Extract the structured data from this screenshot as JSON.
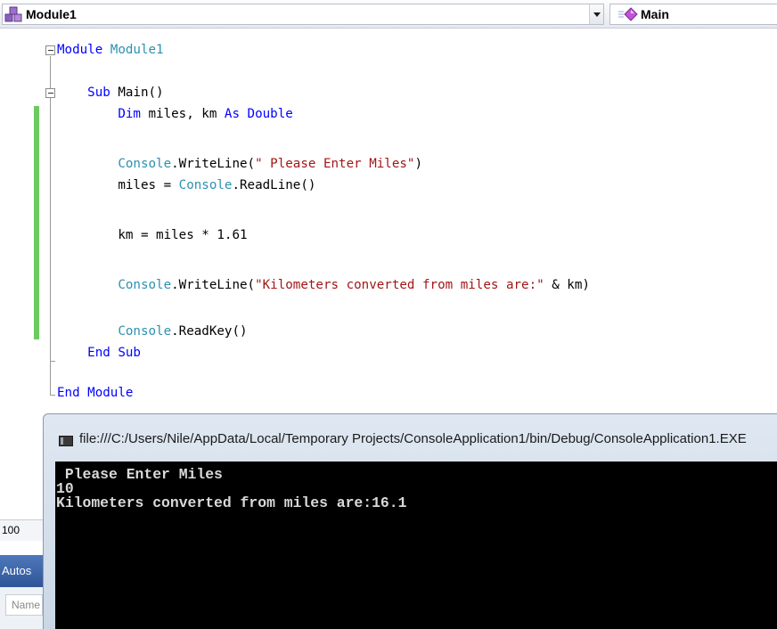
{
  "navigation_bar": {
    "class_selector": {
      "label": "Module1",
      "icon": "module-icon"
    },
    "method_selector": {
      "label": "Main",
      "icon": "method-icon"
    }
  },
  "code_editor": {
    "lines": [
      [
        {
          "t": "Module ",
          "c": "kw"
        },
        {
          "t": "Module1",
          "c": "ty"
        }
      ],
      [
        {
          "t": "    Sub ",
          "c": "kw"
        },
        {
          "t": "Main()",
          "c": ""
        }
      ],
      [
        {
          "t": "        Dim ",
          "c": "kw"
        },
        {
          "t": "miles, km ",
          "c": ""
        },
        {
          "t": "As Double",
          "c": "kw"
        }
      ],
      [
        {
          "t": "        Console",
          "c": "ty"
        },
        {
          "t": ".WriteLine(",
          "c": ""
        },
        {
          "t": "\" Please Enter Miles\"",
          "c": "str"
        },
        {
          "t": ")",
          "c": ""
        }
      ],
      [
        {
          "t": "        miles = ",
          "c": ""
        },
        {
          "t": "Console",
          "c": "ty"
        },
        {
          "t": ".ReadLine()",
          "c": ""
        }
      ],
      [
        {
          "t": "        km = miles * 1.61",
          "c": ""
        }
      ],
      [
        {
          "t": "        Console",
          "c": "ty"
        },
        {
          "t": ".WriteLine(",
          "c": ""
        },
        {
          "t": "\"Kilometers converted from miles are:\"",
          "c": "str"
        },
        {
          "t": " & km)",
          "c": ""
        }
      ],
      [
        {
          "t": "        Console",
          "c": "ty"
        },
        {
          "t": ".ReadKey()",
          "c": ""
        }
      ],
      [
        {
          "t": "    End Sub",
          "c": "kw"
        }
      ],
      [
        {
          "t": "End Module",
          "c": "kw"
        }
      ]
    ]
  },
  "status": {
    "zoom": "100"
  },
  "autos_window": {
    "title": "Autos",
    "column_name": "Name"
  },
  "console_window": {
    "title": "file:///C:/Users/Nile/AppData/Local/Temporary Projects/ConsoleApplication1/bin/Debug/ConsoleApplication1.EXE",
    "output": [
      " Please Enter Miles",
      "10",
      "Kilometers converted from miles are:16.1"
    ]
  },
  "colors": {
    "keyword": "#0000ff",
    "type": "#2b91af",
    "string": "#a31515",
    "change_marker": "#6ccb5f",
    "console_background": "#000000",
    "console_text": "#d9d9d9"
  }
}
